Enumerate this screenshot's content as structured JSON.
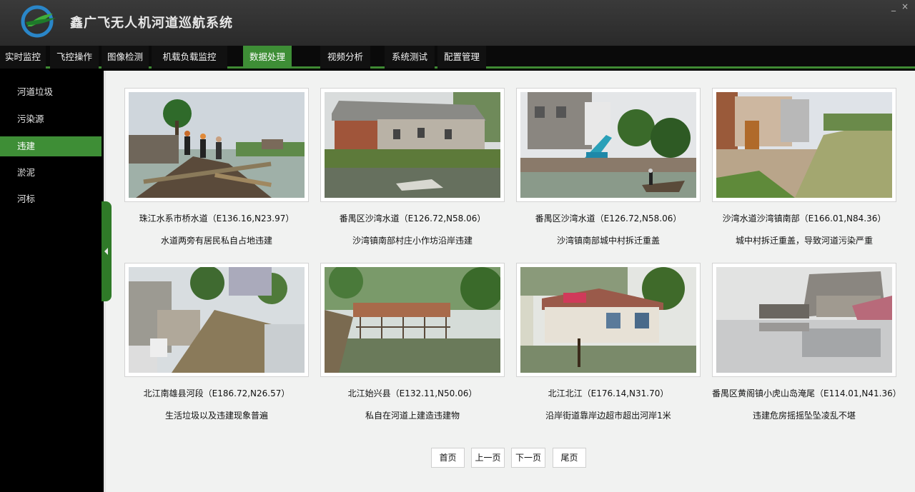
{
  "app": {
    "title": "鑫广飞无人机河道巡航系统"
  },
  "window_controls": {
    "minimize": "_",
    "close": "×"
  },
  "nav": [
    {
      "label": "实时监控"
    },
    {
      "label": "飞控操作"
    },
    {
      "label": "图像检测"
    },
    {
      "label": "机载负载监控"
    },
    {
      "label": "数据处理",
      "active": true
    },
    {
      "label": "视频分析"
    },
    {
      "label": "系统测试"
    },
    {
      "label": "配置管理"
    }
  ],
  "sidebar": [
    {
      "label": "河道垃圾"
    },
    {
      "label": "污染源"
    },
    {
      "label": "违建",
      "active": true
    },
    {
      "label": "淤泥"
    },
    {
      "label": "河标"
    }
  ],
  "cards": [
    {
      "caption": "珠江水系市桥水道（E136.16,N23.97）",
      "desc": "水道两旁有居民私自占地违建",
      "photo": "construction-workers-riverbank"
    },
    {
      "caption": "番禺区沙湾水道（E126.72,N58.06）",
      "desc": "沙湾镇南部村庄小作坊沿岸违建",
      "photo": "old-brick-house-river"
    },
    {
      "caption": "番禺区沙湾水道（E126.72,N58.06）",
      "desc": "沙湾镇南部城中村拆迁重盖",
      "photo": "excavator-river-boat"
    },
    {
      "caption": "沙湾水道沙湾镇南部（E166.01,N84.36）",
      "desc": "城中村拆迁重盖，导致河道污染严重",
      "photo": "demolished-buildings-canal"
    },
    {
      "caption": "北江南雄县河段（E186.72,N26.57）",
      "desc": "生活垃圾以及违建现象普遍",
      "photo": "garbage-shacks-river"
    },
    {
      "caption": "北江始兴县（E132.11,N50.06）",
      "desc": "私自在河道上建造违建物",
      "photo": "scaffold-structure-water"
    },
    {
      "caption": "北江北江（E176.14,N31.70）",
      "desc": "沿岸街道靠岸边超市超出河岸1米",
      "photo": "shop-over-river"
    },
    {
      "caption": "番禺区黄阁镇小虎山岛淹尾（E114.01,N41.36）",
      "desc": "违建危房摇摇坠坠凌乱不堪",
      "photo": "collapsing-houses-water"
    }
  ],
  "pager": {
    "first": "首页",
    "prev": "上一页",
    "next": "下一页",
    "last": "尾页"
  },
  "colors": {
    "accent": "#3e8e36",
    "nav_bg": "#0a0a0a",
    "title_bg": "#333333",
    "main_bg": "#f1f2f1"
  }
}
